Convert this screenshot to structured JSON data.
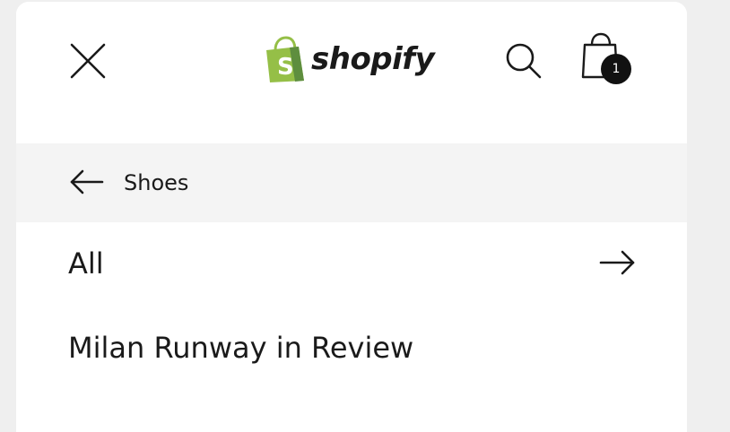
{
  "header": {
    "brand": {
      "name": "shopify",
      "logo_icon": "shopify-bag-icon",
      "logo_color": "#95bf47"
    },
    "close_icon": "close-icon",
    "search_icon": "search-icon",
    "cart": {
      "icon": "shopping-bag-icon",
      "count": "1"
    }
  },
  "submenu": {
    "back_icon": "arrow-left-icon",
    "title": "Shoes",
    "items": [
      {
        "label": "All",
        "icon": "arrow-right-icon"
      },
      {
        "label": "Milan Runway in Review"
      }
    ]
  },
  "colors": {
    "background": "#efefef",
    "panel": "#ffffff",
    "back_row_bg": "#f4f4f4",
    "text": "#1a1a1a",
    "badge_bg": "#111111"
  }
}
